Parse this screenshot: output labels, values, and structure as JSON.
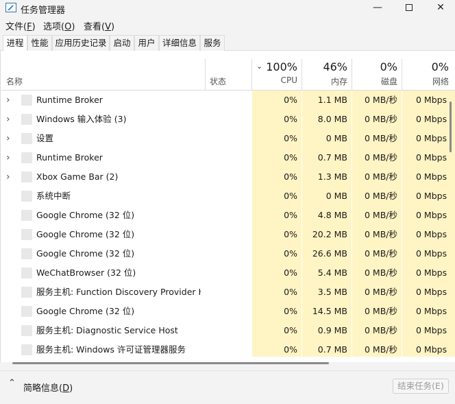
{
  "window": {
    "title": "任务管理器",
    "minimize": "—",
    "close": "✕"
  },
  "menu": [
    {
      "label": "文件",
      "key": "F"
    },
    {
      "label": "选项",
      "key": "O"
    },
    {
      "label": "查看",
      "key": "V"
    }
  ],
  "tabs": [
    "进程",
    "性能",
    "应用历史记录",
    "启动",
    "用户",
    "详细信息",
    "服务"
  ],
  "active_tab": "进程",
  "header": {
    "name": "名称",
    "status": "状态",
    "sort_icon": "chevron-down-icon",
    "cpu": {
      "pct": "100%",
      "label": "CPU"
    },
    "mem": {
      "pct": "46%",
      "label": "内存"
    },
    "disk": {
      "pct": "0%",
      "label": "磁盘"
    },
    "net": {
      "pct": "0%",
      "label": "网络"
    }
  },
  "rows": [
    {
      "expand": true,
      "name": "Runtime Broker",
      "cpu": "0%",
      "mem": "1.1 MB",
      "disk": "0 MB/秒",
      "net": "0 Mbps"
    },
    {
      "expand": true,
      "name": "Windows 输入体验 (3)",
      "cpu": "0%",
      "mem": "8.0 MB",
      "disk": "0 MB/秒",
      "net": "0 Mbps"
    },
    {
      "expand": true,
      "name": "设置",
      "cpu": "0%",
      "mem": "0 MB",
      "disk": "0 MB/秒",
      "net": "0 Mbps"
    },
    {
      "expand": true,
      "name": "Runtime Broker",
      "cpu": "0%",
      "mem": "0.7 MB",
      "disk": "0 MB/秒",
      "net": "0 Mbps"
    },
    {
      "expand": true,
      "name": "Xbox Game Bar (2)",
      "cpu": "0%",
      "mem": "1.3 MB",
      "disk": "0 MB/秒",
      "net": "0 Mbps"
    },
    {
      "expand": false,
      "name": "系统中断",
      "cpu": "0%",
      "mem": "0 MB",
      "disk": "0 MB/秒",
      "net": "0 Mbps"
    },
    {
      "expand": false,
      "name": "Google Chrome (32 位)",
      "cpu": "0%",
      "mem": "4.8 MB",
      "disk": "0 MB/秒",
      "net": "0 Mbps"
    },
    {
      "expand": false,
      "name": "Google Chrome (32 位)",
      "cpu": "0%",
      "mem": "20.2 MB",
      "disk": "0 MB/秒",
      "net": "0 Mbps"
    },
    {
      "expand": false,
      "name": "Google Chrome (32 位)",
      "cpu": "0%",
      "mem": "26.6 MB",
      "disk": "0 MB/秒",
      "net": "0 Mbps"
    },
    {
      "expand": false,
      "name": "WeChatBrowser (32 位)",
      "cpu": "0%",
      "mem": "5.4 MB",
      "disk": "0 MB/秒",
      "net": "0 Mbps"
    },
    {
      "expand": false,
      "name": "服务主机: Function Discovery Provider H...",
      "cpu": "0%",
      "mem": "3.5 MB",
      "disk": "0 MB/秒",
      "net": "0 Mbps"
    },
    {
      "expand": false,
      "name": "Google Chrome (32 位)",
      "cpu": "0%",
      "mem": "14.5 MB",
      "disk": "0 MB/秒",
      "net": "0 Mbps"
    },
    {
      "expand": false,
      "name": "服务主机: Diagnostic Service Host",
      "cpu": "0%",
      "mem": "0.9 MB",
      "disk": "0 MB/秒",
      "net": "0 Mbps"
    },
    {
      "expand": false,
      "name": "服务主机: Windows 许可证管理器服务",
      "cpu": "0%",
      "mem": "0.7 MB",
      "disk": "0 MB/秒",
      "net": "0 Mbps"
    }
  ],
  "footer": {
    "brief_label": "简略信息",
    "brief_key": "D",
    "end_task": "结束任务(E)",
    "collapse_icon": "chevron-up-icon"
  },
  "colors": {
    "heat": "#fff4c4",
    "border": "#dcdcdc"
  }
}
